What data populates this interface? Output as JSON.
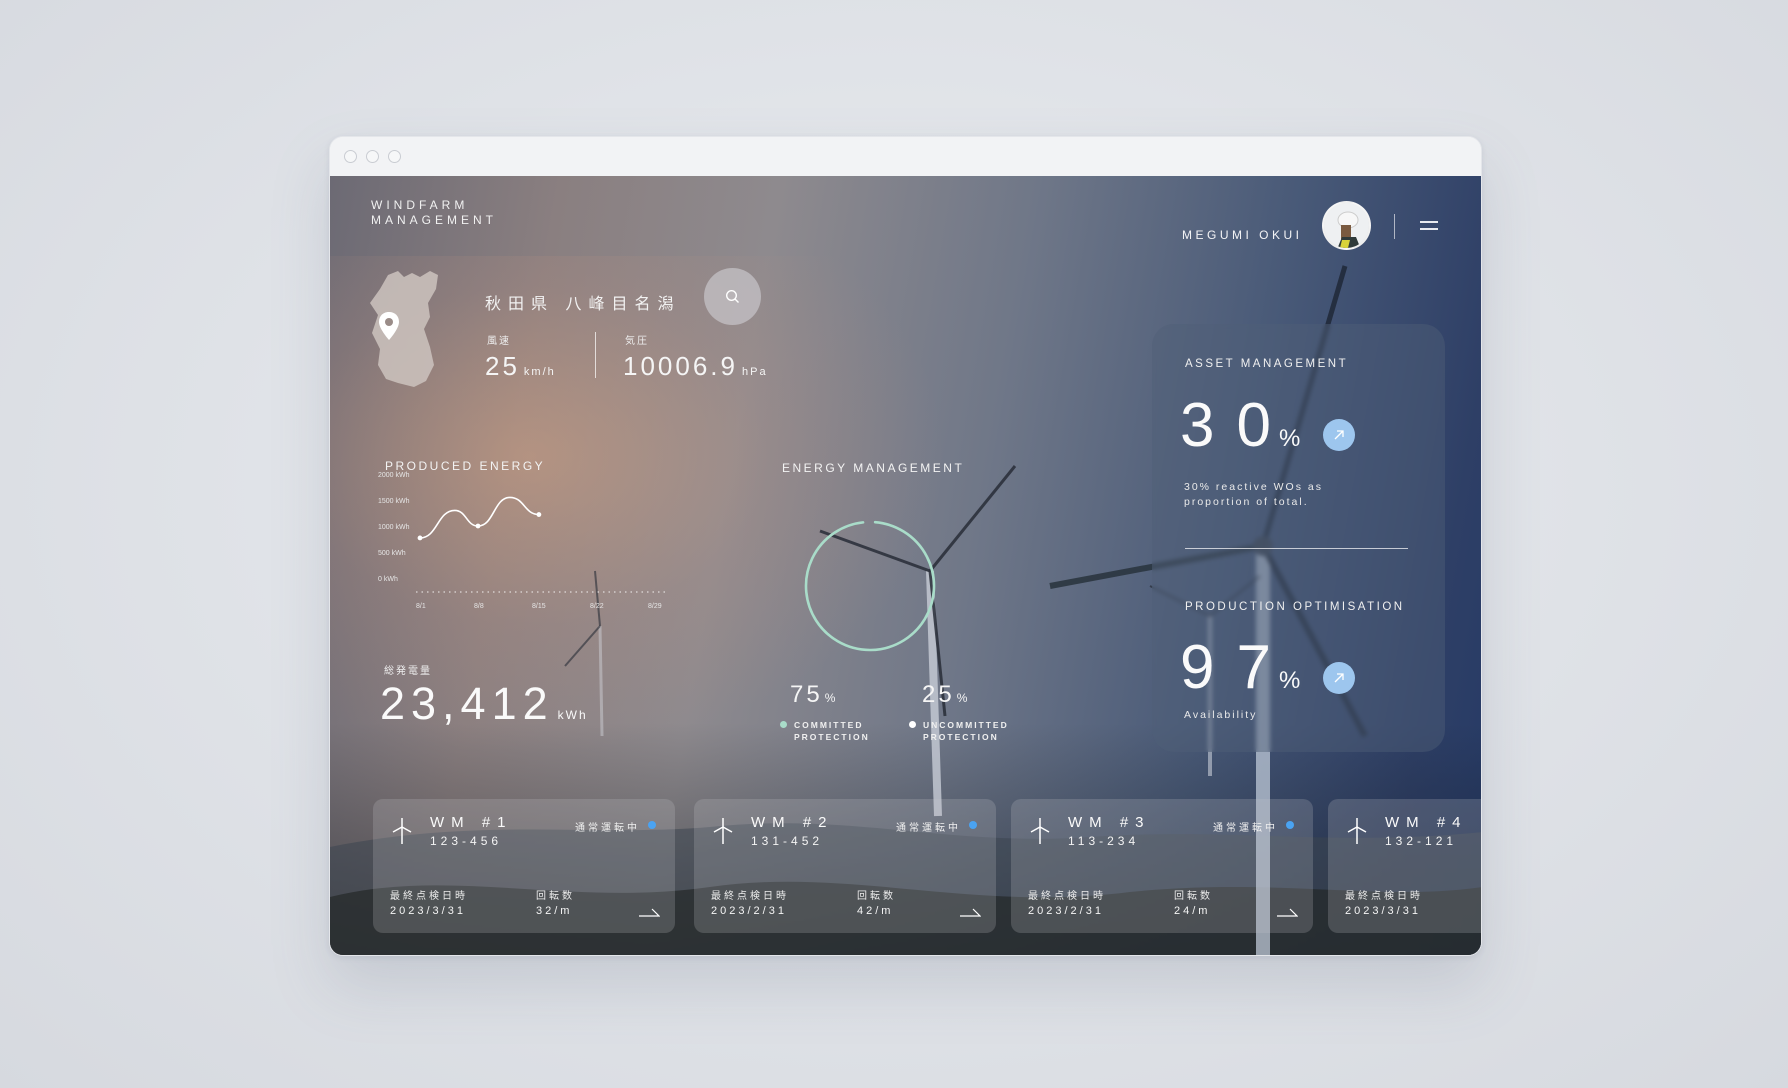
{
  "app": {
    "logo_line1": "WINDFARM",
    "logo_line2": "MANAGEMENT"
  },
  "user": {
    "name": "MEGUMI OKUI"
  },
  "location": {
    "name": "秋田県 八峰目名潟",
    "wind_label": "風速",
    "wind_value": "25",
    "wind_unit": "km/h",
    "pressure_label": "気圧",
    "pressure_value": "10006.9",
    "pressure_unit": "hPa"
  },
  "produced_energy": {
    "title": "PRODUCED ENERGY",
    "total_label": "総発電量",
    "total_value": "23,412",
    "total_unit": "kWh"
  },
  "chart_data": {
    "type": "line",
    "title": "PRODUCED ENERGY",
    "x": [
      "8/1",
      "8/8",
      "8/15",
      "8/22",
      "8/29"
    ],
    "y_ticks": [
      "2000 kWh",
      "1500 kWh",
      "1000 kWh",
      "500 kWh",
      "0 kWh"
    ],
    "ylim": [
      0,
      2000
    ],
    "series": [
      {
        "values": [
          {
            "x": 0.0,
            "y": 770
          },
          {
            "x": 0.6,
            "y": 1300
          },
          {
            "x": 1.0,
            "y": 1000
          },
          {
            "x": 1.55,
            "y": 1550
          },
          {
            "x": 2.05,
            "y": 1220
          }
        ]
      }
    ]
  },
  "energy_management": {
    "title": "ENERGY MANAGEMENT",
    "committed_value": "75",
    "committed_unit": "%",
    "committed_line1": "COMMITTED",
    "committed_line2": "PROTECTION",
    "uncommitted_value": "25",
    "uncommitted_unit": "%",
    "uncommitted_line1": "UNCOMMITTED",
    "uncommitted_line2": "PROTECTION",
    "committed_fraction": 0.97,
    "ring_color": "#a9dcc9"
  },
  "asset_management": {
    "title": "ASSET MANAGEMENT",
    "value": "30",
    "unit": "%",
    "note_line1": "30% reactive WOs as",
    "note_line2": "proportion of total."
  },
  "production_optimisation": {
    "title": "PRODUCTION OPTIMISATION",
    "value": "97",
    "unit": "%",
    "note": "Availability"
  },
  "turbines": [
    {
      "name": "WM #1",
      "code": "123-456",
      "status": "通常運転中",
      "last_check_label": "最終点検日時",
      "last_check": "2023/3/31",
      "rpm_label": "回転数",
      "rpm": "32/m"
    },
    {
      "name": "WM #2",
      "code": "131-452",
      "status": "通常運転中",
      "last_check_label": "最終点検日時",
      "last_check": "2023/2/31",
      "rpm_label": "回転数",
      "rpm": "42/m"
    },
    {
      "name": "WM #3",
      "code": "113-234",
      "status": "通常運転中",
      "last_check_label": "最終点検日時",
      "last_check": "2023/2/31",
      "rpm_label": "回転数",
      "rpm": "24/m"
    },
    {
      "name": "WM #4",
      "code": "132-121",
      "status": "",
      "last_check_label": "最終点検日時",
      "last_check": "2023/3/31",
      "rpm_label": "",
      "rpm": ""
    }
  ],
  "colors": {
    "accent_blue": "#4aa3f2",
    "arrow_bg": "#9dc6ee",
    "ring": "#a9dcc9"
  },
  "icons": [
    "search-icon",
    "menu-icon",
    "arrow-up-right-icon",
    "turbine-icon",
    "location-pin-icon",
    "arrow-right-icon"
  ]
}
